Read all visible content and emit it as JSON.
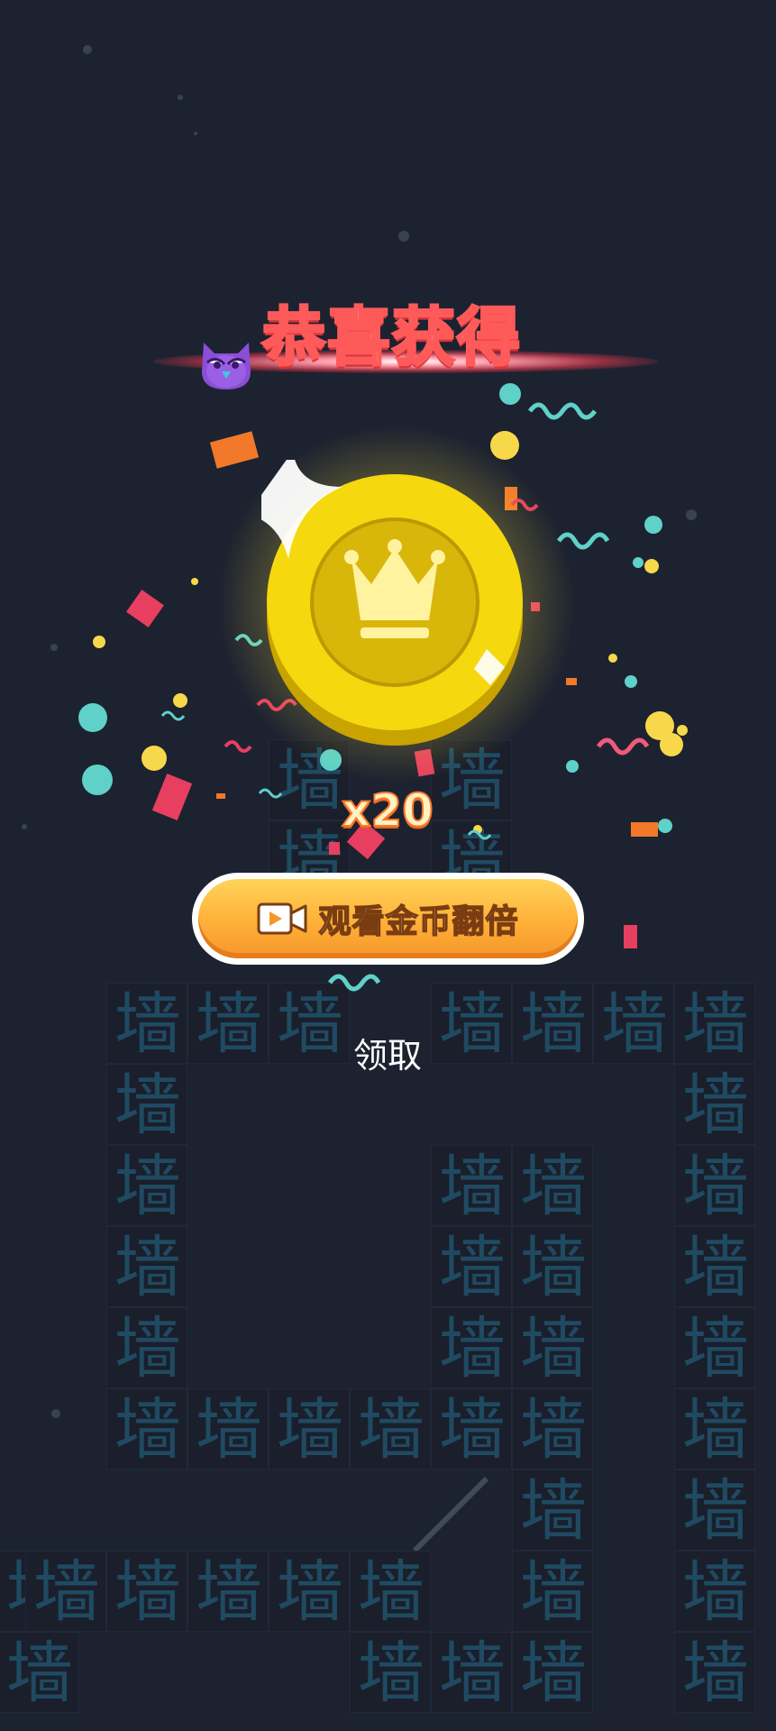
{
  "reward": {
    "title": "恭喜获得",
    "multiplier_text": "x20",
    "coin_icon": "crown-coin-icon",
    "mascot_icon": "purple-owl-icon"
  },
  "actions": {
    "double_label": "观看金币翻倍",
    "double_icon": "video-camera-icon",
    "claim_label": "领取"
  },
  "game": {
    "wall_char": "墙"
  },
  "colors": {
    "background": "#1d2230",
    "wall_text": "#1f4a62",
    "title_outline": "#ff5a5a",
    "button_orange": "#ffb33a",
    "coin_yellow": "#f5d80e"
  }
}
